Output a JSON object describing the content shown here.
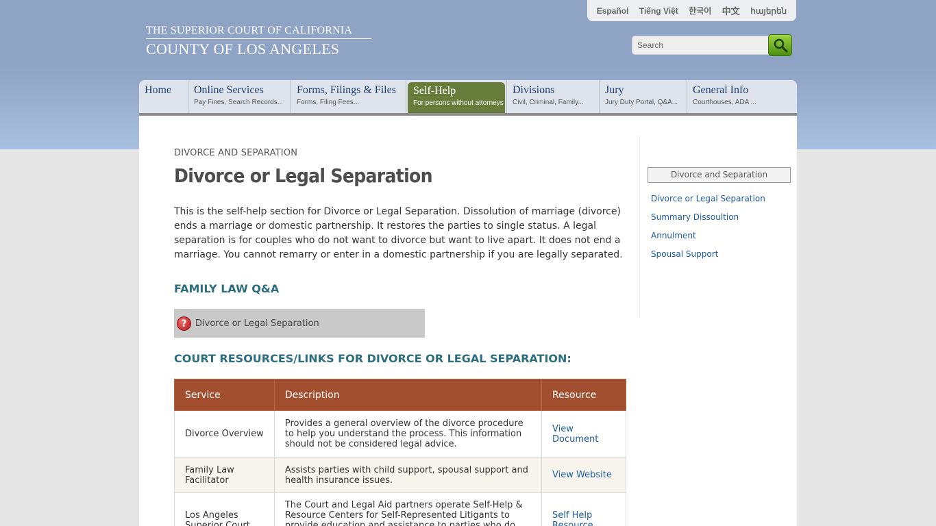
{
  "header": {
    "languages": [
      "Español",
      "Tiếng Việt",
      "한국어",
      "中文",
      "հայերեն"
    ],
    "logo_line1": "THE SUPERIOR COURT OF CALIFORNIA",
    "logo_line2": "COUNTY OF LOS ANGELES",
    "search_placeholder": "Search"
  },
  "nav": [
    {
      "title": "Home",
      "subtitle": ""
    },
    {
      "title": "Online Services",
      "subtitle": "Pay Fines, Search Records..."
    },
    {
      "title": "Forms, Filings & Files",
      "subtitle": "Forms, Filing Fees..."
    },
    {
      "title": "Self-Help",
      "subtitle": "For persons without attorneys"
    },
    {
      "title": "Divisions",
      "subtitle": "Civil, Criminal, Family..."
    },
    {
      "title": "Jury",
      "subtitle": "Jury Duty Portal, Q&A..."
    },
    {
      "title": "General Info",
      "subtitle": "Courthouses, ADA ..."
    }
  ],
  "main": {
    "eyebrow": "DIVORCE AND SEPARATION",
    "title": "Divorce or Legal Separation",
    "intro": "This is the self-help section for Divorce or Legal Separation. Dissolution of marriage (divorce) ends a marriage or domestic partnership. It restores the parties to single status. A legal separation is for couples who do not want to divorce but want to live apart. It does not end a marriage. You cannot remarry or enter in a domestic partnership if you are legally separated.",
    "qa_heading": "FAMILY LAW Q&A",
    "qa_item": "Divorce or Legal Separation",
    "resources_heading": "COURT RESOURCES/LINKS FOR DIVORCE OR LEGAL SEPARATION:",
    "table": {
      "headers": [
        "Service",
        "Description",
        "Resource"
      ],
      "rows": [
        {
          "service": "Divorce Overview",
          "description": "Provides a general overview of the divorce procedure to help you understand the process. This information should not be considered legal advice.",
          "resource": "View Document"
        },
        {
          "service": "Family Law Facilitator",
          "description": "Assists parties with child support, spousal support and health insurance issues.",
          "resource": "View Website"
        },
        {
          "service": "Los Angeles Superior Court",
          "description": "The Court and Legal Aid partners operate Self-Help & Resource Centers for Self-Represented Litigants to provide education and assistance to parties who do not have",
          "resource": "Self Help Resource"
        }
      ]
    }
  },
  "sidebar": {
    "heading": "Divorce and Separation",
    "links": [
      "Divorce or Legal Separation",
      "Summary Dissoultion",
      "Annulment",
      "Spousal Support"
    ]
  },
  "colors": {
    "header_band": "#8fa3c4",
    "nav_active": "#687d3b",
    "table_header": "#a24f2f",
    "section_heading": "#2d6e7e",
    "link": "#1c5c9c"
  },
  "icons": {
    "search": "magnifier-icon",
    "qa": "question-mark-icon"
  }
}
